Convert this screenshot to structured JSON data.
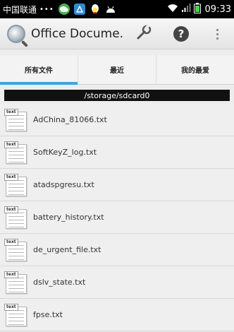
{
  "status_bar": {
    "carrier": "中国联通",
    "dots": "•••",
    "time": "09:33"
  },
  "action_bar": {
    "title": "Office Docume."
  },
  "tabs": [
    {
      "label": "所有文件",
      "active": true
    },
    {
      "label": "最近",
      "active": false
    },
    {
      "label": "我的最爱",
      "active": false
    }
  ],
  "path": "/storage/sdcard0",
  "files": [
    {
      "name": "AdChina_81066.txt",
      "tag": "text"
    },
    {
      "name": "SoftKeyZ_log.txt",
      "tag": "text"
    },
    {
      "name": "atadspgresu.txt",
      "tag": "text"
    },
    {
      "name": "battery_history.txt",
      "tag": "text"
    },
    {
      "name": "de_urgent_file.txt",
      "tag": "text"
    },
    {
      "name": "dslv_state.txt",
      "tag": "text"
    },
    {
      "name": "fpse.txt",
      "tag": "text"
    }
  ],
  "colors": {
    "accent": "#3ba7dc",
    "path_bar": "#111111"
  }
}
